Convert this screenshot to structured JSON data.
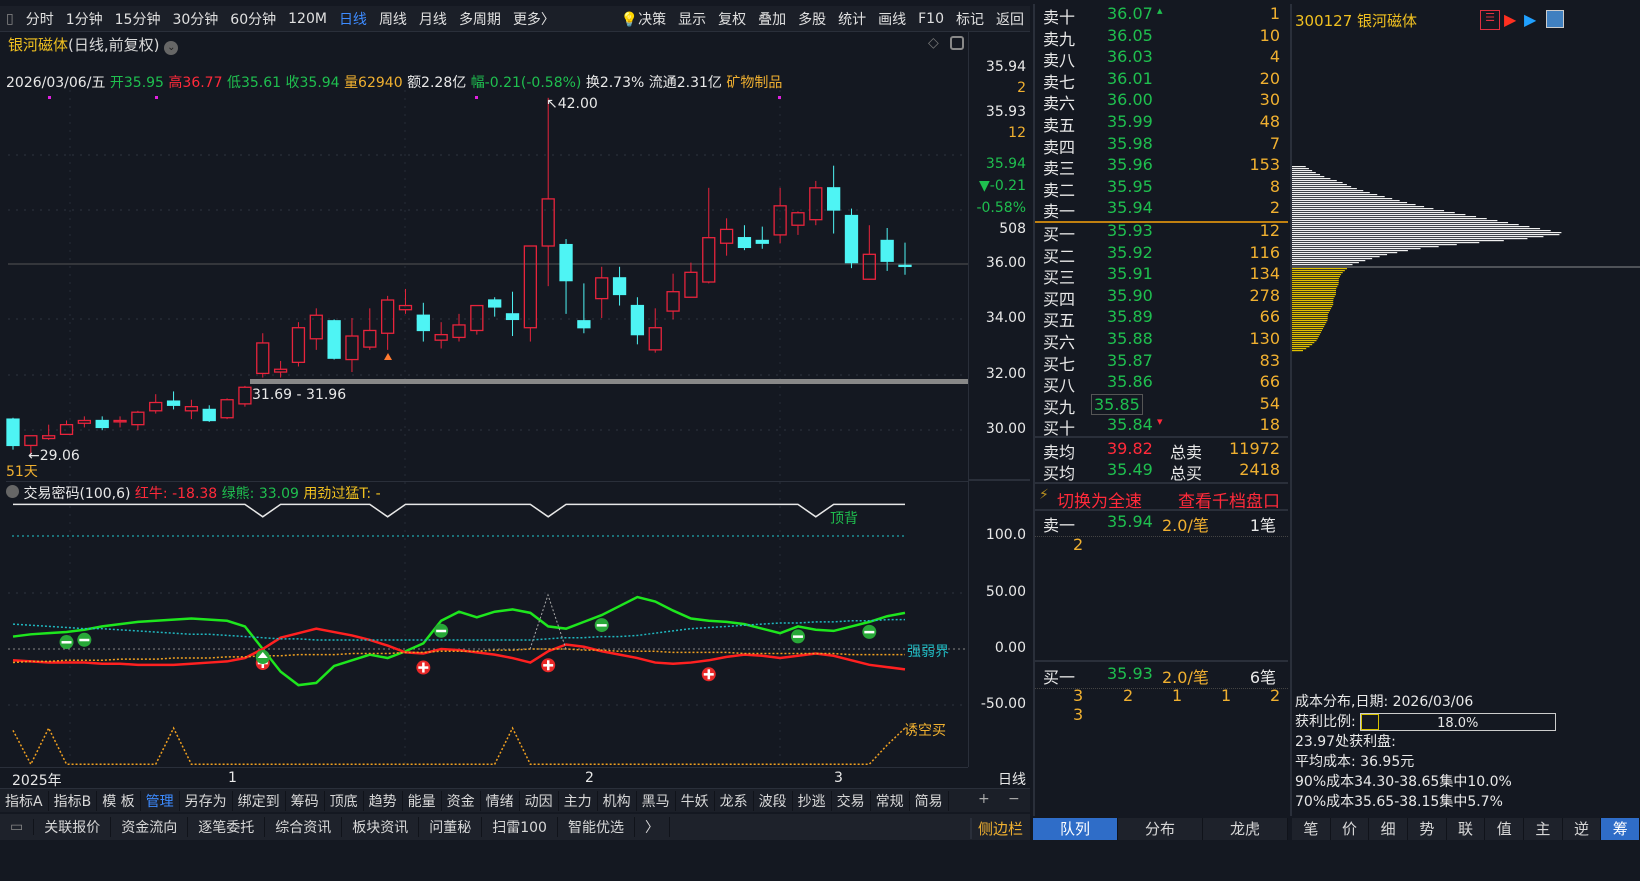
{
  "toolbar": {
    "periods": [
      "分时",
      "1分钟",
      "15分钟",
      "30分钟",
      "60分钟",
      "120M",
      "日线",
      "周线",
      "月线",
      "多周期",
      "更多〉"
    ],
    "active_period": "日线",
    "decision": "决策",
    "tools": [
      "显示",
      "复权",
      "叠加",
      "多股",
      "统计",
      "画线",
      "F10",
      "标记",
      "返回"
    ]
  },
  "chart": {
    "stock_name": "银河磁体",
    "mode": "(日线,前复权)",
    "info": {
      "date": "2026/03/06/五",
      "open": "开35.95",
      "high": "高36.77",
      "low": "低35.61",
      "close": "收35.94",
      "volume": "量62940",
      "amount": "额2.28亿",
      "change": "幅-0.21(-0.58%)",
      "turnover": "换2.73%",
      "float": "流通2.31亿",
      "industry": "矿物制品"
    },
    "annotations": {
      "max": "42.00",
      "range": "31.69 - 31.96",
      "min": "29.06",
      "days": "51天"
    },
    "axis": {
      "a1": "35.94",
      "a2": "2",
      "a3": "35.93",
      "a4": "12",
      "a5": "35.94",
      "a6": "▼-0.21",
      "a7": "-0.58%",
      "a8": "508",
      "p36": "36.00",
      "p34": "34.00",
      "p32": "32.00",
      "p30": "30.00"
    }
  },
  "indicator": {
    "name": "交易密码(100,6)",
    "red": "红牛: -18.38",
    "green": "绿熊: 33.09",
    "force": "用劲过猛T: -",
    "label_top": "顶背",
    "label_mid": "强弱界",
    "label_bot": "诱空买",
    "axis": {
      "a100": "100.0",
      "a50": "50.00",
      "a0": "0.00",
      "am50": "-50.00"
    }
  },
  "time_axis": {
    "year": "2025年",
    "m1": "1",
    "m2": "2",
    "m3": "3",
    "period": "日线",
    "plus": "+",
    "minus": "−"
  },
  "bottom_tabs": [
    "指标A",
    "指标B",
    "模 板",
    "管理",
    "另存为",
    "绑定到",
    "筹码",
    "顶底",
    "趋势",
    "能量",
    "资金",
    "情绪",
    "动因",
    "主力",
    "机构",
    "黑马",
    "牛妖",
    "龙系",
    "波段",
    "抄逃",
    "交易",
    "常规",
    "简易"
  ],
  "bottom_tabs_active": "管理",
  "bottom_bar": [
    "关联报价",
    "资金流向",
    "逐笔委托",
    "综合资讯",
    "板块资讯",
    "问董秘",
    "扫雷100",
    "智能优选",
    "〉"
  ],
  "sidebar_label": "侧边栏",
  "orderbook": {
    "sell": [
      {
        "label": "卖十",
        "price": "36.07",
        "vol": "1"
      },
      {
        "label": "卖九",
        "price": "36.05",
        "vol": "10"
      },
      {
        "label": "卖八",
        "price": "36.03",
        "vol": "4"
      },
      {
        "label": "卖七",
        "price": "36.01",
        "vol": "20"
      },
      {
        "label": "卖六",
        "price": "36.00",
        "vol": "30"
      },
      {
        "label": "卖五",
        "price": "35.99",
        "vol": "48"
      },
      {
        "label": "卖四",
        "price": "35.98",
        "vol": "7"
      },
      {
        "label": "卖三",
        "price": "35.96",
        "vol": "153"
      },
      {
        "label": "卖二",
        "price": "35.95",
        "vol": "8"
      },
      {
        "label": "卖一",
        "price": "35.94",
        "vol": "2"
      }
    ],
    "buy": [
      {
        "label": "买一",
        "price": "35.93",
        "vol": "12"
      },
      {
        "label": "买二",
        "price": "35.92",
        "vol": "116"
      },
      {
        "label": "买三",
        "price": "35.91",
        "vol": "134"
      },
      {
        "label": "买四",
        "price": "35.90",
        "vol": "278"
      },
      {
        "label": "买五",
        "price": "35.89",
        "vol": "66"
      },
      {
        "label": "买六",
        "price": "35.88",
        "vol": "130"
      },
      {
        "label": "买七",
        "price": "35.87",
        "vol": "83"
      },
      {
        "label": "买八",
        "price": "35.86",
        "vol": "66"
      },
      {
        "label": "买九",
        "price": "35.85",
        "vol": "54"
      },
      {
        "label": "买十",
        "price": "35.84",
        "vol": "18"
      }
    ],
    "sell_avg": {
      "label": "卖均",
      "price": "39.82",
      "total_label": "总卖",
      "total": "11972"
    },
    "buy_avg": {
      "label": "买均",
      "price": "35.49",
      "total_label": "总买",
      "total": "2418"
    }
  },
  "queue": {
    "fast": "切换为全速",
    "depth": "查看千档盘口",
    "sell1": {
      "label": "卖一",
      "price": "35.94",
      "avg": "2.0/笔",
      "count": "1笔",
      "orders": [
        "2"
      ]
    },
    "buy1": {
      "label": "买一",
      "price": "35.93",
      "avg": "2.0/笔",
      "count": "6笔",
      "orders": [
        "3",
        "2",
        "1",
        "1",
        "2",
        "3"
      ]
    },
    "tabs": [
      "队列",
      "分布",
      "龙虎"
    ],
    "active_tab": "队列"
  },
  "chip": {
    "title": "300127 银河磁体",
    "date_line": "成本分布,日期: 2026/03/06",
    "profit_label": "获利比例:",
    "profit_text": "18.0%",
    "profit_ratio": 0.18,
    "line1": "23.97处获利盘:",
    "line2": "平均成本: 36.95元",
    "line3": "90%成本34.30-38.65集中10.0%",
    "line4": "70%成本35.65-38.15集中5.7%",
    "profile_white": [
      0.05,
      0.08,
      0.12,
      0.18,
      0.22,
      0.28,
      0.35,
      0.42,
      0.5,
      0.6,
      0.7,
      0.8,
      0.9,
      1.0,
      0.85,
      0.62,
      0.45,
      0.35,
      0.28,
      0.22
    ],
    "profile_yellow": [
      0.2,
      0.18,
      0.17,
      0.17,
      0.16,
      0.16,
      0.15,
      0.15,
      0.14,
      0.13,
      0.13,
      0.12,
      0.11,
      0.1,
      0.09,
      0.07,
      0.04
    ],
    "tabs": [
      "笔",
      "价",
      "细",
      "势",
      "联",
      "值",
      "主",
      "逆",
      "筹"
    ],
    "active_tab": "筹"
  },
  "colors": {
    "up": "#e8243c",
    "down": "#4ef4f4",
    "green_line": "#1ee61e",
    "red_line": "#ff2020",
    "teal": "#20b8c0",
    "orange": "#f0a020",
    "accent": "#2f6dc8"
  },
  "chart_data": {
    "type": "candlestick",
    "count": 51,
    "open": [
      30.4,
      29.45,
      29.7,
      29.85,
      30.25,
      30.35,
      30.3,
      30.2,
      30.7,
      31.05,
      30.7,
      30.75,
      30.45,
      30.95,
      32.05,
      32.1,
      32.45,
      33.3,
      33.95,
      32.55,
      33.0,
      33.5,
      34.35,
      34.15,
      33.25,
      33.35,
      33.6,
      34.7,
      34.2,
      33.7,
      36.65,
      36.7,
      33.95,
      34.75,
      35.5,
      34.5,
      32.9,
      34.3,
      34.8,
      35.35,
      36.75,
      36.95,
      36.85,
      37.05,
      37.4,
      37.6,
      38.75,
      37.75,
      35.45,
      36.85,
      35.95
    ],
    "close": [
      29.45,
      29.8,
      29.8,
      30.2,
      30.35,
      30.1,
      30.35,
      30.65,
      31.0,
      30.9,
      30.85,
      30.35,
      31.1,
      31.55,
      33.15,
      32.2,
      33.7,
      34.15,
      32.6,
      33.4,
      33.6,
      34.7,
      34.5,
      33.6,
      33.45,
      33.8,
      34.5,
      34.45,
      34.0,
      36.65,
      38.35,
      35.4,
      33.7,
      35.5,
      34.9,
      33.45,
      33.7,
      35.0,
      35.7,
      36.95,
      37.25,
      36.6,
      36.75,
      38.1,
      37.85,
      38.75,
      37.95,
      36.05,
      36.35,
      36.1,
      35.94
    ],
    "high": [
      30.45,
      29.8,
      30.2,
      30.35,
      30.5,
      30.5,
      30.5,
      30.7,
      31.3,
      31.4,
      31.1,
      30.9,
      31.15,
      31.6,
      33.5,
      32.5,
      33.9,
      34.4,
      34.0,
      34.05,
      34.4,
      34.85,
      35.1,
      34.6,
      33.9,
      34.2,
      34.5,
      34.8,
      35.0,
      36.65,
      42.0,
      36.9,
      35.3,
      35.9,
      35.9,
      34.8,
      34.4,
      35.65,
      36.05,
      38.75,
      37.65,
      37.4,
      37.35,
      38.75,
      37.9,
      39.0,
      39.55,
      38.0,
      37.4,
      37.3,
      36.77
    ],
    "low": [
      29.3,
      29.06,
      29.65,
      29.85,
      30.1,
      30.0,
      30.1,
      30.0,
      30.6,
      30.75,
      30.4,
      30.3,
      30.4,
      30.85,
      31.9,
      31.9,
      32.3,
      32.9,
      32.55,
      32.1,
      32.9,
      32.9,
      34.2,
      33.2,
      32.95,
      33.2,
      33.45,
      34.1,
      33.4,
      33.2,
      35.2,
      34.2,
      33.5,
      34.05,
      34.5,
      33.1,
      32.8,
      34.0,
      34.8,
      35.3,
      36.3,
      36.5,
      36.55,
      36.75,
      37.05,
      37.4,
      37.1,
      35.85,
      35.45,
      35.75,
      35.61
    ],
    "price_ylim": [
      28.5,
      43
    ],
    "indicator_series": [
      {
        "name": "绿熊",
        "values": [
          11,
          13,
          14,
          15,
          17,
          20,
          22,
          24,
          25,
          26,
          27,
          26,
          25,
          20,
          0,
          -20,
          -32,
          -30,
          -15,
          -10,
          -5,
          -8,
          -2,
          5,
          25,
          33,
          28,
          33,
          35,
          32,
          20,
          18,
          24,
          30,
          38,
          46,
          42,
          34,
          27,
          25,
          24,
          22,
          18,
          14,
          20,
          17,
          16,
          20,
          24,
          29,
          32
        ]
      },
      {
        "name": "红牛",
        "values": [
          -10,
          -11,
          -12,
          -12,
          -12,
          -13,
          -13,
          -14,
          -14,
          -14,
          -13,
          -12,
          -11,
          -8,
          0,
          10,
          14,
          18,
          15,
          12,
          8,
          3,
          -3,
          -4,
          0,
          -1,
          -3,
          -5,
          -8,
          -12,
          -2,
          4,
          2,
          -2,
          -5,
          -8,
          -12,
          -13,
          -12,
          -10,
          -7,
          -5,
          -6,
          -8,
          -6,
          -4,
          -6,
          -10,
          -14,
          -16,
          -18
        ]
      },
      {
        "name": "强弱界",
        "values": [
          22,
          21,
          20,
          19,
          18,
          18,
          17,
          16,
          15,
          14,
          13,
          13,
          12,
          11,
          10,
          9,
          9,
          8,
          8,
          8,
          8,
          8,
          8,
          8,
          8,
          8,
          8,
          8,
          8,
          8,
          9,
          10,
          10,
          11,
          11,
          12,
          14,
          16,
          18,
          19,
          20,
          21,
          22,
          23,
          23,
          24,
          24,
          25,
          25,
          26,
          26
        ]
      },
      {
        "name": "orange",
        "values": [
          -12,
          -11,
          -11,
          -10,
          -10,
          -10,
          -9,
          -9,
          -9,
          -8,
          -8,
          -8,
          -7,
          -7,
          -6,
          -6,
          -5,
          -5,
          -5,
          -4,
          -4,
          -4,
          -3,
          -3,
          -2,
          -2,
          -2,
          -1,
          -1,
          0,
          0,
          0,
          -1,
          -1,
          -2,
          -2,
          -2,
          -3,
          -3,
          -3,
          -3,
          -4,
          -4,
          -4,
          -4,
          -4,
          -4,
          -5,
          -5,
          -5,
          -5
        ]
      },
      {
        "name": "顶背",
        "values": [
          128,
          128,
          128,
          128,
          128,
          128,
          128,
          128,
          128,
          128,
          128,
          128,
          128,
          128,
          117,
          128,
          128,
          128,
          128,
          128,
          128,
          117,
          128,
          128,
          128,
          128,
          128,
          128,
          128,
          128,
          117,
          128,
          128,
          128,
          128,
          128,
          128,
          128,
          128,
          128,
          128,
          128,
          128,
          128,
          128,
          117,
          128,
          128,
          128,
          128,
          128
        ]
      },
      {
        "name": "诱空买",
        "values": [
          -72,
          -102,
          -70,
          -102,
          -102,
          -102,
          -102,
          -102,
          -102,
          -70,
          -102,
          -102,
          -102,
          -102,
          -102,
          -102,
          -102,
          -102,
          -102,
          -102,
          -102,
          -102,
          -102,
          -102,
          -102,
          -102,
          -102,
          -102,
          -70,
          -102,
          -102,
          -102,
          -102,
          -102,
          -102,
          -102,
          -102,
          -102,
          -102,
          -102,
          -102,
          -102,
          -102,
          -102,
          -102,
          -102,
          -102,
          -102,
          -102,
          -85,
          -70
        ]
      }
    ],
    "indicator_ylim": [
      -110,
      135
    ],
    "markers": {
      "minus": [
        3,
        4,
        24,
        33,
        44,
        48
      ],
      "up_arrow": [
        14
      ],
      "plus": [
        14,
        23,
        30,
        39
      ]
    }
  }
}
